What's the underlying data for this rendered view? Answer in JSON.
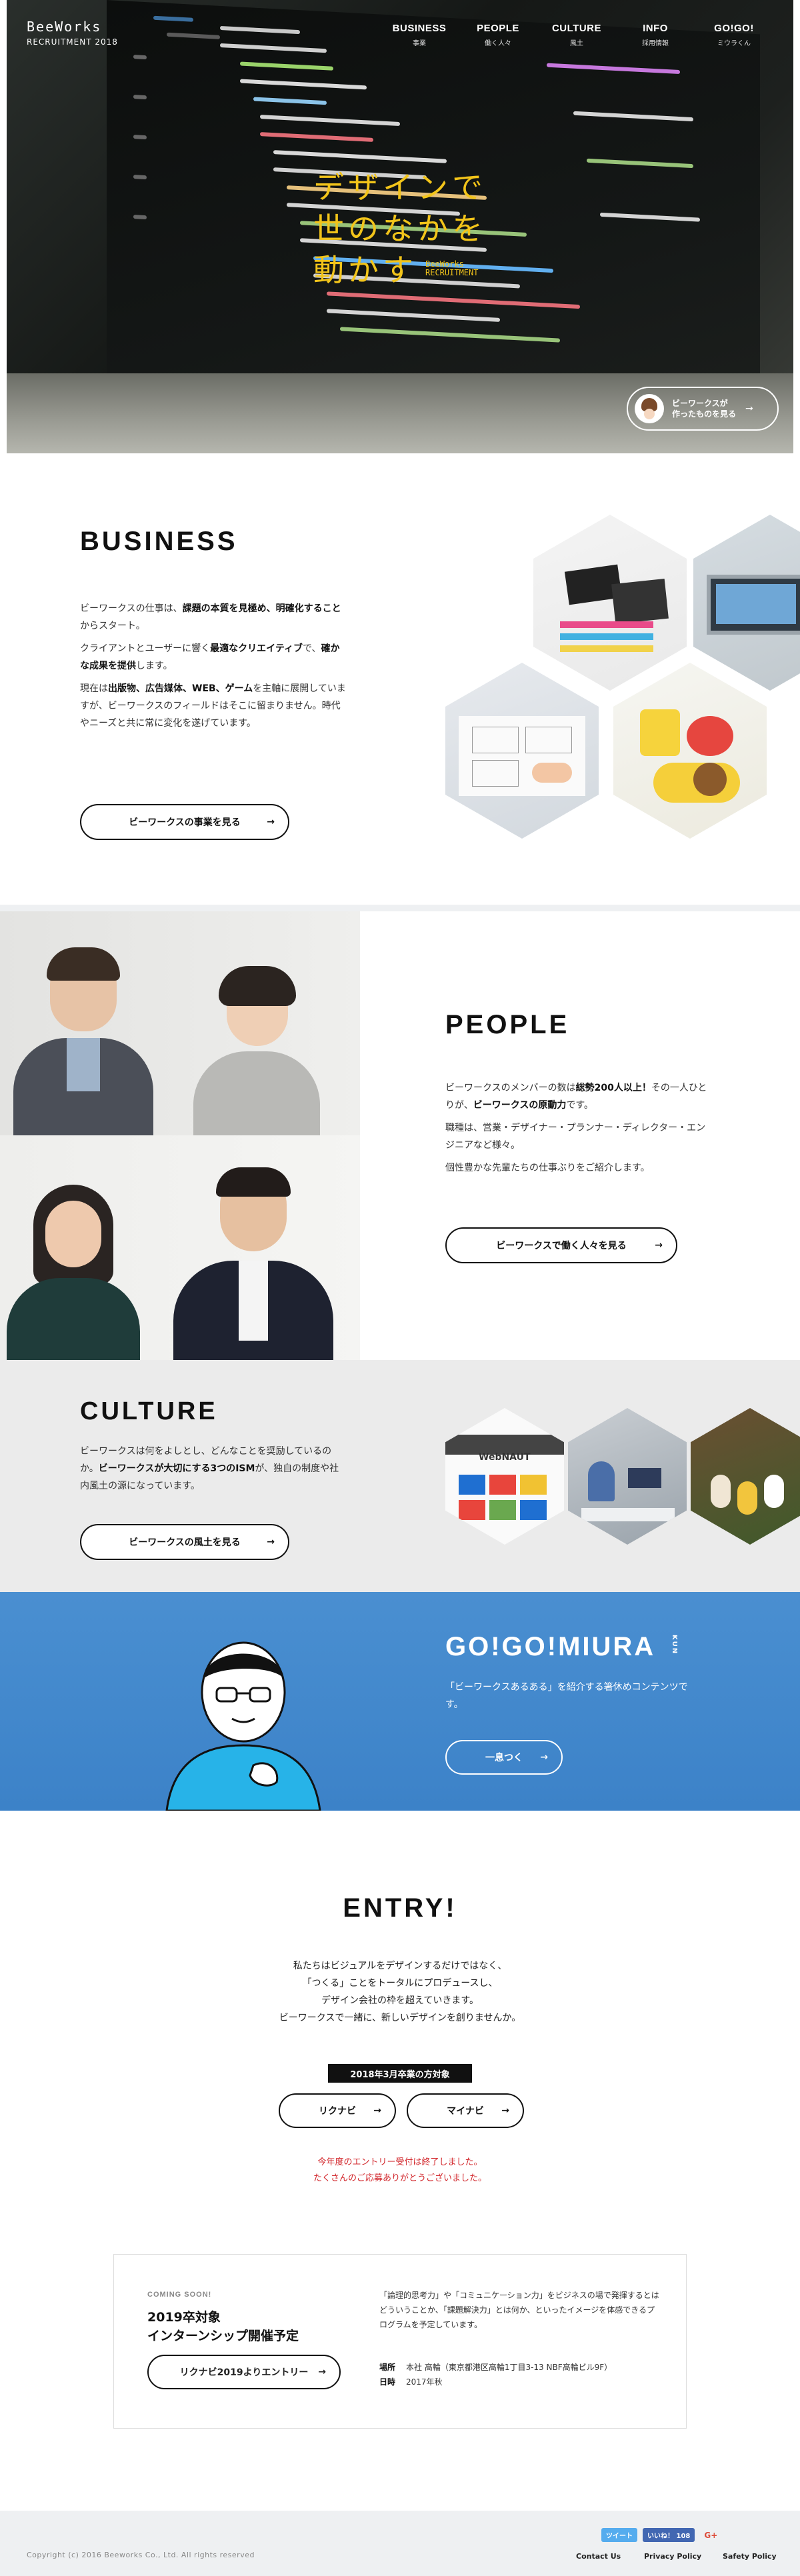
{
  "hero": {
    "logo_line1": "BeeWorks",
    "logo_line2": "RECRUITMENT 2018",
    "nav": [
      {
        "en": "BUSINESS",
        "jp": "事業"
      },
      {
        "en": "PEOPLE",
        "jp": "働く人々"
      },
      {
        "en": "CULTURE",
        "jp": "風土"
      },
      {
        "en": "INFO",
        "jp": "採用情報"
      },
      {
        "en": "GO!GO!",
        "jp": "ミウラくん"
      }
    ],
    "copy_line1": "デザインで",
    "copy_line2": "世のなかを",
    "copy_line3": "動かす",
    "copy_badge_1": "BeeWorks",
    "copy_badge_2": "RECRUITMENT",
    "cta_line1": "ビーワークスが",
    "cta_line2": "作ったものを見る",
    "cta_arrow": "→"
  },
  "business": {
    "title": "BUSINESS",
    "p1_a": "ビーワークスの仕事は、",
    "p1_b": "課題の本質を見極め、明確化すること",
    "p1_c": "からスタート。",
    "p2_a": "クライアントとユーザーに響く",
    "p2_b": "最適なクリエイティブ",
    "p2_c": "で、",
    "p2_d": "確かな成果を提供",
    "p2_e": "します。",
    "p3_a": "現在は",
    "p3_b": "出版物、広告媒体、WEB、ゲーム",
    "p3_c": "を主軸に展開していますが、ビーワークスのフィールドはそこに留まりません。時代やニーズと共に常に変化を遂げています。",
    "button": "ビーワークスの事業を見る",
    "arrow": "→"
  },
  "people": {
    "title": "PEOPLE",
    "p1_a": "ビーワークスのメンバーの数は",
    "p1_b": "総勢200人以上！",
    "p1_c": "その一人ひとりが、",
    "p1_d": "ビーワークスの原動力",
    "p1_e": "です。",
    "p2": "職種は、営業・デザイナー・プランナー・ディレクター・エンジニアなど様々。",
    "p3": "個性豊かな先輩たちの仕事ぶりをご紹介します。",
    "button": "ビーワークスで働く人々を見る",
    "arrow": "→"
  },
  "culture": {
    "title": "CULTURE",
    "p_a": "ビーワークスは何をよしとし、どんなことを奨励しているのか。",
    "p_b": "ビーワークスが大切にする3つのISM",
    "p_c": "が、独自の制度や社内風土の源になっています。",
    "button": "ビーワークスの風土を見る",
    "arrow": "→",
    "hex1_label": "WebNAUT"
  },
  "miura": {
    "title": "GO!GO!MIURA",
    "kun": "KUN",
    "desc": "「ビーワークスあるある」を紹介する箸休めコンテンツです。",
    "button": "一息つく",
    "arrow": "→"
  },
  "entry": {
    "title": "ENTRY!",
    "lead": [
      "私たちはビジュアルをデザインするだけではなく、",
      "「つくる」ことをトータルにプロデュースし、",
      "デザイン会社の枠を超えていきます。",
      "ビーワークスで一緒に、新しいデザインを創りませんか。"
    ],
    "target": "2018年3月卒業の方対象",
    "btn_rikunabi": "リクナビ",
    "btn_mynavi": "マイナビ",
    "arrow": "→",
    "notice": [
      "今年度のエントリー受付は終了しました。",
      "たくさんのご応募ありがとうございました。"
    ],
    "intern": {
      "soon": "COMING SOON!",
      "head1": "2019卒対象",
      "head2": "インターンシップ開催予定",
      "button": "リクナビ2019よりエントリー",
      "desc": "「論理的思考力」や「コミュニケーション力」をビジネスの場で発揮するとはどういうことか、「課題解決力」とは何か、といったイメージを体感できるプログラムを予定しています。",
      "place_label": "場所",
      "place": "本社 高輪（東京都港区高輪1丁目3-13 NBF高輪ビル9F）",
      "date_label": "日時",
      "date": "2017年秋"
    }
  },
  "footer": {
    "copyright": "Copyright (c) 2016 Beeworks Co., Ltd. All rights reserved",
    "tweet": "ツイート",
    "like": "いいね！ 108",
    "gplus": "G+",
    "contact": "Contact Us",
    "privacy": "Privacy Policy",
    "safety": "Safety Policy"
  }
}
